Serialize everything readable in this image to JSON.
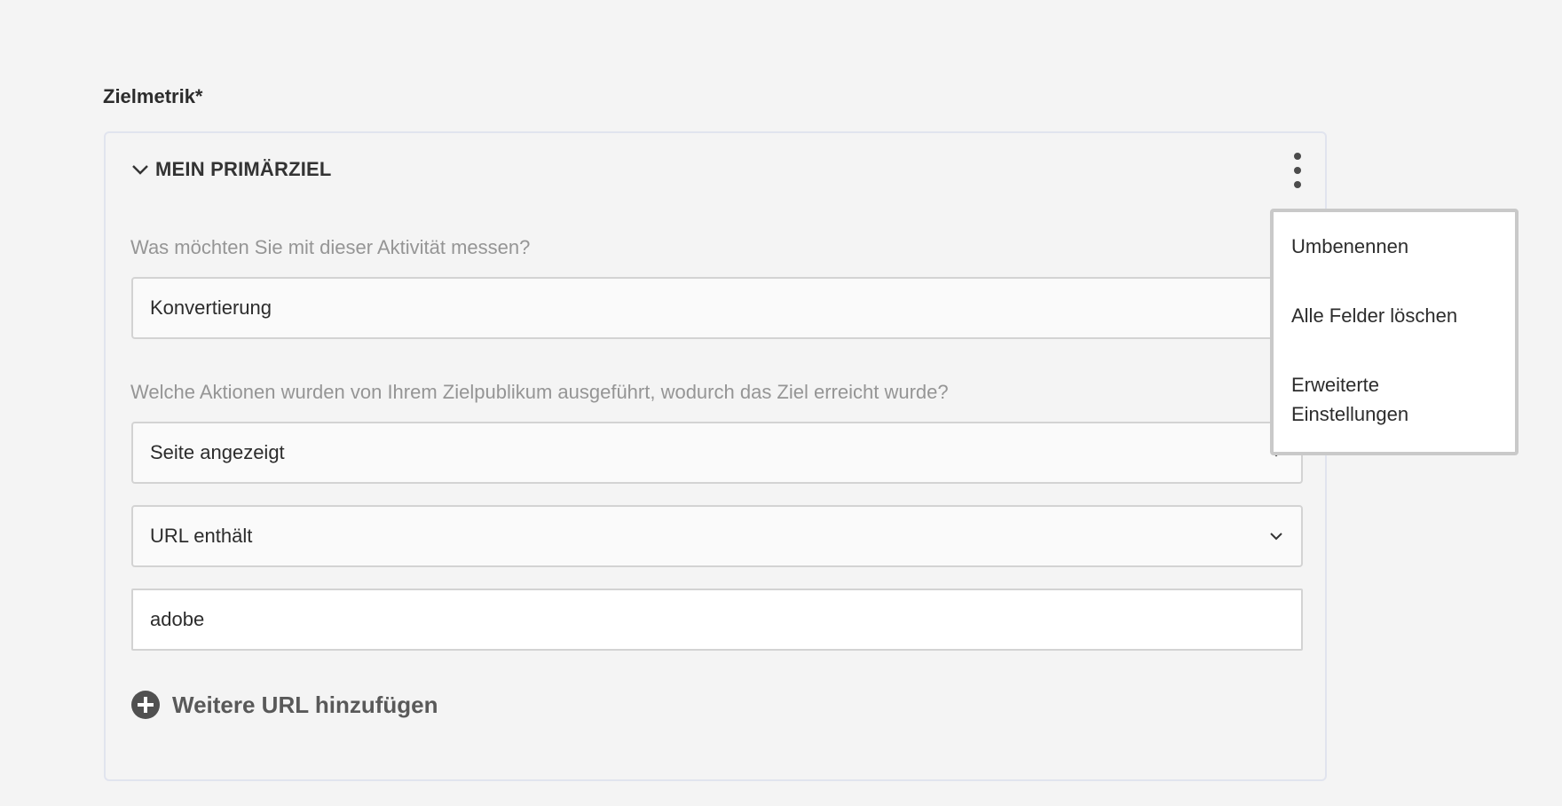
{
  "section": {
    "label": "Zielmetrik*"
  },
  "goal": {
    "title": "MEIN PRIMÄRZIEL",
    "collapse_icon": "chevron-down-icon",
    "more_icon": "more-vertical-icon",
    "question_measure": "Was möchten Sie mit dieser Aktivität messen?",
    "measure_value": "Konvertierung",
    "question_action": "Welche Aktionen wurden von Ihrem Zielpublikum ausgeführt, wodurch das Ziel erreicht wurde?",
    "action_value": "Seite angezeigt",
    "url_condition_value": "URL enthält",
    "url_input_value": "adobe",
    "add_url_label": "Weitere URL hinzufügen",
    "add_url_icon": "add-circle-icon"
  },
  "menu": {
    "items": [
      {
        "label": "Umbenennen"
      },
      {
        "label": "Alle Felder löschen"
      },
      {
        "label": "Erweiterte Einstellungen"
      }
    ]
  },
  "colors": {
    "background": "#f4f4f4",
    "card_border": "#e1e4ee",
    "field_border": "#d3d3d3",
    "question_text": "#959595",
    "menu_border": "#c9c9c9"
  }
}
